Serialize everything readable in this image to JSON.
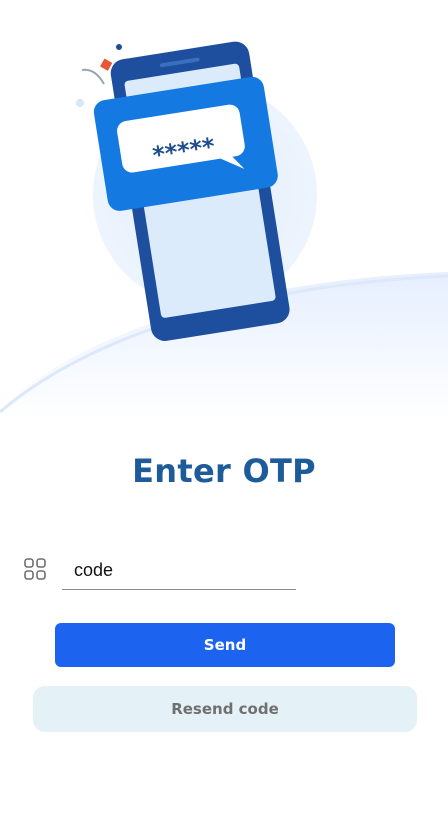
{
  "screen": {
    "title": "Enter OTP",
    "illustration_text": "*****"
  },
  "code_field": {
    "icon": "grid-icon",
    "value": "code",
    "placeholder": "code"
  },
  "actions": {
    "send_label": "Send",
    "resend_label": "Resend code"
  },
  "colors": {
    "title": "#1e5b9a",
    "send_button": "#1c63f0",
    "resend_button_bg": "#e4f1f6",
    "resend_button_text": "#707070"
  }
}
